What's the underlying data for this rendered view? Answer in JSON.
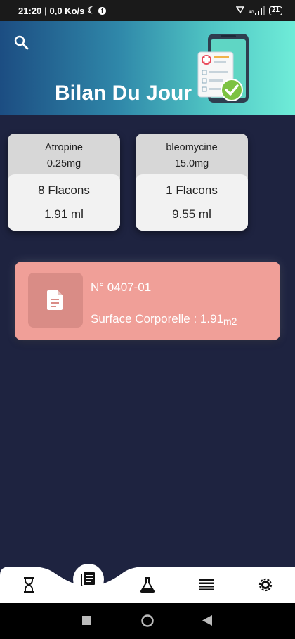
{
  "status_bar": {
    "time": "21:20",
    "speed": "| 0,0 Ko/s",
    "network": "4G",
    "battery": "21"
  },
  "header": {
    "title": "Bilan Du Jour"
  },
  "drugs": [
    {
      "name": "Atropine",
      "dose": "0.25mg",
      "flacons": "8 Flacons",
      "volume": "1.91 ml"
    },
    {
      "name": "bleomycine",
      "dose": "15.0mg",
      "flacons": "1 Flacons",
      "volume": "9.55 ml"
    }
  ],
  "patient": {
    "number": "N° 0407-01",
    "surface_label": "Surface Corporelle : 1.91",
    "surface_unit": "m2"
  },
  "bottom_nav": {
    "items": [
      "hourglass-icon",
      "document-icon",
      "flask-icon",
      "list-icon",
      "gear-icon"
    ],
    "active": "document-icon"
  },
  "colors": {
    "background": "#1e2340",
    "patient_card": "#f09f98",
    "header_start": "#1c4d82",
    "header_end": "#6fecd8"
  }
}
